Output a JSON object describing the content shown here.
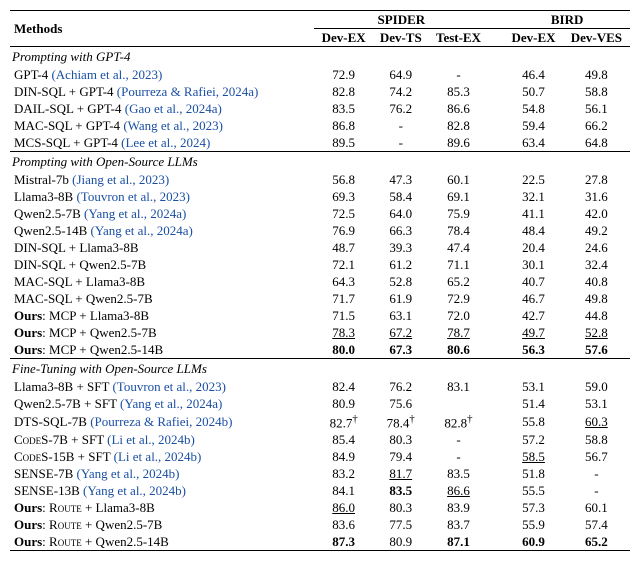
{
  "header": {
    "methods": "Methods",
    "spider": "SPIDER",
    "bird": "BIRD",
    "devex": "Dev-EX",
    "devts": "Dev-TS",
    "testex": "Test-EX",
    "bdevex": "Dev-EX",
    "bdevves": "Dev-VES"
  },
  "sections": [
    {
      "title": "Prompting with GPT-4",
      "rows": [
        {
          "method_prefix": "GPT-4 ",
          "cite": "(Achiam et al., 2023)",
          "v": [
            {
              "t": "72.9"
            },
            {
              "t": "64.9"
            },
            {
              "t": "-"
            },
            {
              "t": "46.4"
            },
            {
              "t": "49.8"
            }
          ]
        },
        {
          "method_prefix": "DIN-SQL + GPT-4 ",
          "cite": "(Pourreza & Rafiei, 2024a)",
          "v": [
            {
              "t": "82.8"
            },
            {
              "t": "74.2"
            },
            {
              "t": "85.3"
            },
            {
              "t": "50.7"
            },
            {
              "t": "58.8"
            }
          ]
        },
        {
          "method_prefix": "DAIL-SQL + GPT-4 ",
          "cite": "(Gao et al., 2024a)",
          "v": [
            {
              "t": "83.5"
            },
            {
              "t": "76.2"
            },
            {
              "t": "86.6"
            },
            {
              "t": "54.8"
            },
            {
              "t": "56.1"
            }
          ]
        },
        {
          "method_prefix": "MAC-SQL + GPT-4 ",
          "cite": "(Wang et al., 2023)",
          "v": [
            {
              "t": "86.8"
            },
            {
              "t": "-"
            },
            {
              "t": "82.8"
            },
            {
              "t": "59.4"
            },
            {
              "t": "66.2"
            }
          ]
        },
        {
          "method_prefix": "MCS-SQL + GPT-4 ",
          "cite": "(Lee et al., 2024)",
          "v": [
            {
              "t": "89.5"
            },
            {
              "t": "-"
            },
            {
              "t": "89.6"
            },
            {
              "t": "63.4"
            },
            {
              "t": "64.8"
            }
          ]
        }
      ]
    },
    {
      "title": "Prompting with Open-Source LLMs",
      "rows": [
        {
          "method_prefix": "Mistral-7b ",
          "cite": "(Jiang et al., 2023)",
          "v": [
            {
              "t": "56.8"
            },
            {
              "t": "47.3"
            },
            {
              "t": "60.1"
            },
            {
              "t": "22.5"
            },
            {
              "t": "27.8"
            }
          ]
        },
        {
          "method_prefix": "Llama3-8B ",
          "cite": "(Touvron et al., 2023)",
          "v": [
            {
              "t": "69.3"
            },
            {
              "t": "58.4"
            },
            {
              "t": "69.1"
            },
            {
              "t": "32.1"
            },
            {
              "t": "31.6"
            }
          ]
        },
        {
          "method_prefix": "Qwen2.5-7B ",
          "cite": "(Yang et al., 2024a)",
          "v": [
            {
              "t": "72.5"
            },
            {
              "t": "64.0"
            },
            {
              "t": "75.9"
            },
            {
              "t": "41.1"
            },
            {
              "t": "42.0"
            }
          ]
        },
        {
          "method_prefix": "Qwen2.5-14B ",
          "cite": "(Yang et al., 2024a)",
          "v": [
            {
              "t": "76.9"
            },
            {
              "t": "66.3"
            },
            {
              "t": "78.4"
            },
            {
              "t": "48.4"
            },
            {
              "t": "49.2"
            }
          ]
        },
        {
          "method_prefix": "DIN-SQL + Llama3-8B",
          "cite": "",
          "v": [
            {
              "t": "48.7"
            },
            {
              "t": "39.3"
            },
            {
              "t": "47.4"
            },
            {
              "t": "20.4"
            },
            {
              "t": "24.6"
            }
          ]
        },
        {
          "method_prefix": "DIN-SQL + Qwen2.5-7B",
          "cite": "",
          "v": [
            {
              "t": "72.1"
            },
            {
              "t": "61.2"
            },
            {
              "t": "71.1"
            },
            {
              "t": "30.1"
            },
            {
              "t": "32.4"
            }
          ]
        },
        {
          "method_prefix": "MAC-SQL + Llama3-8B",
          "cite": "",
          "v": [
            {
              "t": "64.3"
            },
            {
              "t": "52.8"
            },
            {
              "t": "65.2"
            },
            {
              "t": "40.7"
            },
            {
              "t": "40.8"
            }
          ]
        },
        {
          "method_prefix": "MAC-SQL + Qwen2.5-7B",
          "cite": "",
          "v": [
            {
              "t": "71.7"
            },
            {
              "t": "61.9"
            },
            {
              "t": "72.9"
            },
            {
              "t": "46.7"
            },
            {
              "t": "49.8"
            }
          ]
        },
        {
          "method_bold": "Ours",
          "method_rest": ": MCP + Llama3-8B",
          "v": [
            {
              "t": "71.5"
            },
            {
              "t": "63.1"
            },
            {
              "t": "72.0"
            },
            {
              "t": "42.7"
            },
            {
              "t": "44.8"
            }
          ]
        },
        {
          "method_bold": "Ours",
          "method_rest": ": MCP + Qwen2.5-7B",
          "v": [
            {
              "t": "78.3",
              "u": true
            },
            {
              "t": "67.2",
              "u": true
            },
            {
              "t": "78.7",
              "u": true
            },
            {
              "t": "49.7",
              "u": true
            },
            {
              "t": "52.8",
              "u": true
            }
          ]
        },
        {
          "method_bold": "Ours",
          "method_rest": ": MCP + Qwen2.5-14B",
          "v": [
            {
              "t": "80.0",
              "b": true
            },
            {
              "t": "67.3",
              "b": true
            },
            {
              "t": "80.6",
              "b": true
            },
            {
              "t": "56.3",
              "b": true
            },
            {
              "t": "57.6",
              "b": true
            }
          ]
        }
      ]
    },
    {
      "title": "Fine-Tuning with Open-Source LLMs",
      "rows": [
        {
          "method_prefix": "Llama3-8B + SFT ",
          "cite": "(Touvron et al., 2023)",
          "v": [
            {
              "t": "82.4"
            },
            {
              "t": "76.2"
            },
            {
              "t": "83.1"
            },
            {
              "t": "53.1"
            },
            {
              "t": "59.0"
            }
          ]
        },
        {
          "method_prefix": "Qwen2.5-7B + SFT ",
          "cite": "(Yang et al., 2024a)",
          "v": [
            {
              "t": "80.9"
            },
            {
              "t": "75.6"
            },
            {
              "t": ""
            },
            {
              "t": "51.4"
            },
            {
              "t": "53.1"
            }
          ]
        },
        {
          "method_prefix": "DTS-SQL-7B ",
          "cite": "(Pourreza & Rafiei, 2024b)",
          "v": [
            {
              "t": "82.7",
              "dag": true
            },
            {
              "t": "78.4",
              "dag": true
            },
            {
              "t": "82.8",
              "dag": true
            },
            {
              "t": "55.8"
            },
            {
              "t": "60.3",
              "u": true
            }
          ]
        },
        {
          "method_prefix_sc": "CodeS",
          "method_after": "-7B + SFT ",
          "cite": "(Li et al., 2024b)",
          "v": [
            {
              "t": "85.4"
            },
            {
              "t": "80.3"
            },
            {
              "t": "-"
            },
            {
              "t": "57.2"
            },
            {
              "t": "58.8"
            }
          ]
        },
        {
          "method_prefix_sc": "CodeS",
          "method_after": "-15B + SFT ",
          "cite": "(Li et al., 2024b)",
          "v": [
            {
              "t": "84.9"
            },
            {
              "t": "79.4"
            },
            {
              "t": "-"
            },
            {
              "t": "58.5",
              "u": true
            },
            {
              "t": "56.7"
            }
          ]
        },
        {
          "method_prefix_sc": "SENSE",
          "method_after": "-7B ",
          "cite": "(Yang et al., 2024b)",
          "v": [
            {
              "t": "83.2"
            },
            {
              "t": "81.7",
              "u": true
            },
            {
              "t": "83.5"
            },
            {
              "t": "51.8"
            },
            {
              "t": "-"
            }
          ]
        },
        {
          "method_prefix_sc": "SENSE",
          "method_after": "-13B ",
          "cite": "(Yang et al., 2024b)",
          "v": [
            {
              "t": "84.1"
            },
            {
              "t": "83.5",
              "b": true
            },
            {
              "t": "86.6",
              "u": true
            },
            {
              "t": "55.5"
            },
            {
              "t": "-"
            }
          ]
        },
        {
          "method_bold": "Ours",
          "method_rest_sc": ": Route + Llama3-8B",
          "sc_word": "Route",
          "v": [
            {
              "t": "86.0",
              "u": true
            },
            {
              "t": "80.3"
            },
            {
              "t": "83.9"
            },
            {
              "t": "57.3"
            },
            {
              "t": "60.1"
            }
          ]
        },
        {
          "method_bold": "Ours",
          "method_rest_sc": ": Route + Qwen2.5-7B",
          "sc_word": "Route",
          "v": [
            {
              "t": "83.6"
            },
            {
              "t": "77.5"
            },
            {
              "t": "83.7"
            },
            {
              "t": "55.9"
            },
            {
              "t": "57.4"
            }
          ]
        },
        {
          "method_bold": "Ours",
          "method_rest_sc": ": Route + Qwen2.5-14B",
          "sc_word": "Route",
          "v": [
            {
              "t": "87.3",
              "b": true
            },
            {
              "t": "80.9"
            },
            {
              "t": "87.1",
              "b": true
            },
            {
              "t": "60.9",
              "b": true
            },
            {
              "t": "65.2",
              "b": true
            }
          ]
        }
      ]
    }
  ]
}
